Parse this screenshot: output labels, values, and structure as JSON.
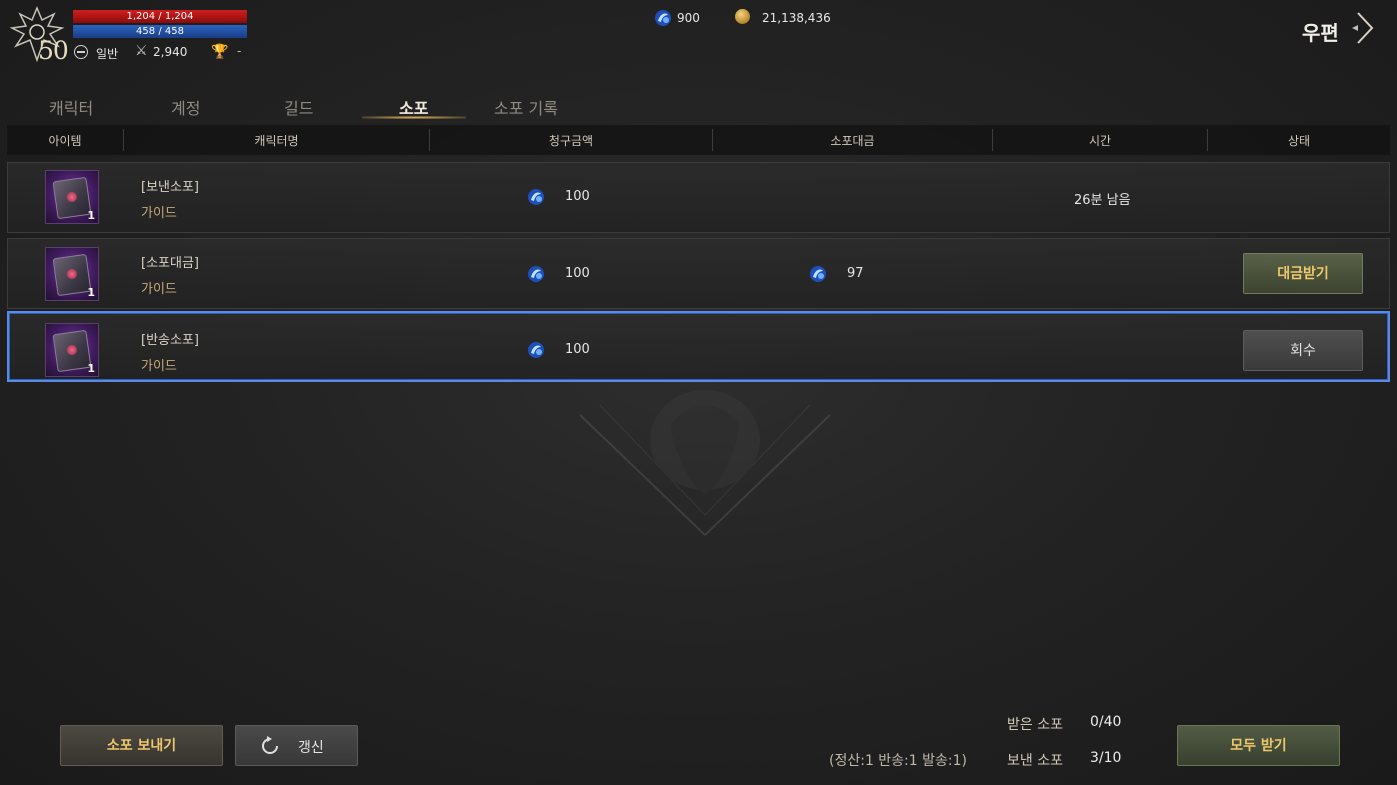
{
  "player": {
    "level": "50",
    "hp": "1,204 / 1,204",
    "mp": "458 / 458",
    "stance": "일반",
    "combat_power": "2,940",
    "rank": "-"
  },
  "currency": {
    "gems": "900",
    "gold": "21,138,436"
  },
  "mail": {
    "title": "우편"
  },
  "tabs": [
    {
      "label": "캐릭터"
    },
    {
      "label": "계정"
    },
    {
      "label": "길드"
    },
    {
      "label": "소포",
      "active": true
    },
    {
      "label": "소포 기록"
    }
  ],
  "table": {
    "headers": [
      "아이템",
      "캐릭터명",
      "청구금액",
      "소포대금",
      "시간",
      "상태"
    ],
    "rows": [
      {
        "type": "[보낸소포]",
        "name": "가이드",
        "qty": "1",
        "charge": "100",
        "payment": "",
        "time": "26분 남음",
        "status": ""
      },
      {
        "type": "[소포대금]",
        "name": "가이드",
        "qty": "1",
        "charge": "100",
        "payment": "97",
        "time": "",
        "status": "대금받기"
      },
      {
        "type": "[반송소포]",
        "name": "가이드",
        "qty": "1",
        "charge": "100",
        "payment": "",
        "time": "",
        "status": "회수"
      }
    ]
  },
  "footer": {
    "send_label": "소포 보내기",
    "refresh_label": "갱신",
    "received_label": "받은 소포",
    "received_value": "0/40",
    "sent_detail": "(정산:1 반송:1 발송:1)",
    "sent_label": "보낸 소포",
    "sent_value": "3/10",
    "receive_all_label": "모두 받기"
  },
  "colors": {
    "accent": "#f0c86c",
    "selected_border": "#5b8ae6",
    "hp": "#d11e1e",
    "mp": "#2c62c0"
  },
  "icons": [
    "emblem-icon",
    "stance-icon",
    "combat-power-icon",
    "trophy-icon",
    "gem-icon",
    "gold-coin-icon",
    "close-arrow-icon",
    "spellbook-icon",
    "refresh-icon"
  ]
}
